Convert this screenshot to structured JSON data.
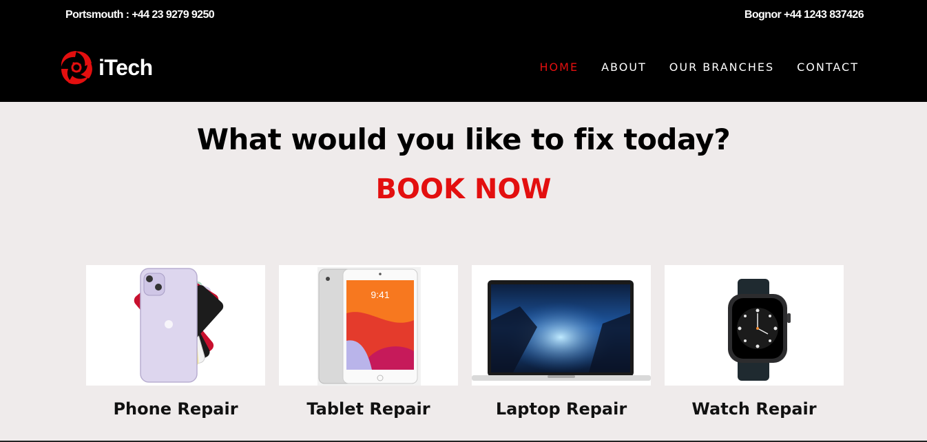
{
  "header": {
    "phone_left": "Portsmouth : +44 23 9279 9250",
    "phone_right": "Bognor +44 1243 837426",
    "logo_text": "iTech",
    "nav": [
      {
        "label": "HOME",
        "active": true
      },
      {
        "label": "ABOUT",
        "active": false
      },
      {
        "label": "OUR BRANCHES",
        "active": false
      },
      {
        "label": "CONTACT",
        "active": false
      }
    ]
  },
  "main": {
    "headline": "What would you like to fix today?",
    "cta": "BOOK NOW",
    "services": [
      {
        "label": "Phone Repair",
        "icon": "phone-image"
      },
      {
        "label": "Tablet Repair",
        "icon": "tablet-image"
      },
      {
        "label": "Laptop Repair",
        "icon": "laptop-image"
      },
      {
        "label": "Watch Repair",
        "icon": "watch-image"
      }
    ]
  },
  "colors": {
    "accent": "#e30f0f",
    "header_bg": "#000000",
    "page_bg": "#efebeb"
  }
}
